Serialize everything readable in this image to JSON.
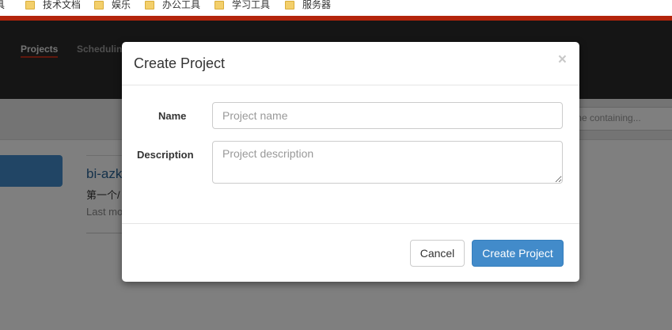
{
  "bookmarks": {
    "items": [
      {
        "label": "具"
      },
      {
        "label": "技术文档"
      },
      {
        "label": "娱乐"
      },
      {
        "label": "办公工具"
      },
      {
        "label": "学习工具"
      },
      {
        "label": "服务器"
      }
    ]
  },
  "navbar": {
    "tabs": [
      {
        "label": "Projects",
        "active": true
      },
      {
        "label": "Scheduling"
      }
    ]
  },
  "toolbar": {
    "search_placeholder": "me containing..."
  },
  "project_list": {
    "items": [
      {
        "name": "bi-azk",
        "description": "第一个/",
        "meta": "Last mo"
      }
    ]
  },
  "modal": {
    "title": "Create Project",
    "close_glyph": "×",
    "name_label": "Name",
    "name_placeholder": "Project name",
    "name_value": "",
    "description_label": "Description",
    "description_placeholder": "Project description",
    "description_value": "",
    "cancel_label": "Cancel",
    "create_label": "Create Project"
  },
  "colors": {
    "primary": "#428bca",
    "navbar": "#2b2b2b",
    "accent_stripe": "#b3240b"
  }
}
